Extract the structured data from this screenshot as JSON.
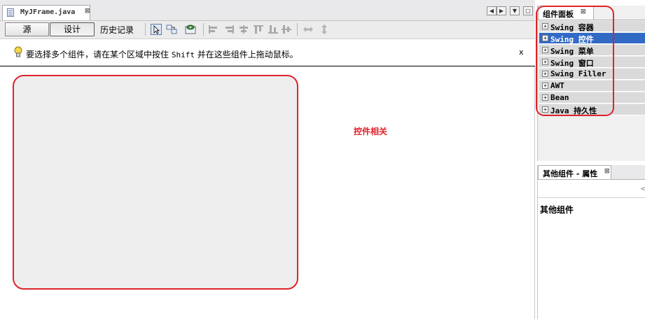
{
  "editor": {
    "tab_title": "MyJFrame.java",
    "tab_close": "⊠",
    "nav_left": "◀",
    "nav_right": "▶",
    "menu_glyph": "▼",
    "maximize_glyph": "□"
  },
  "toolbar": {
    "source_label": "源",
    "design_label": "设计",
    "history_label": "历史记录"
  },
  "hint": {
    "text_before": "要选择多个组件，请在某个区域中按住",
    "key": "Shift",
    "text_after": "并在这些组件上拖动鼠标。",
    "close_label": "x"
  },
  "canvas": {
    "annotation": "控件相关",
    "highlight_color": "#e0222c"
  },
  "palette": {
    "title": "组件面板",
    "close_label": "⊠",
    "categories": [
      {
        "label": "Swing 容器",
        "selected": false
      },
      {
        "label": "Swing 控件",
        "selected": true
      },
      {
        "label": "Swing 菜单",
        "selected": false
      },
      {
        "label": "Swing 窗口",
        "selected": false
      },
      {
        "label": "Swing Filler",
        "selected": false
      },
      {
        "label": "AWT",
        "selected": false
      },
      {
        "label": "Bean",
        "selected": false
      },
      {
        "label": "Java 持久性",
        "selected": false
      }
    ],
    "expand_glyph": "+",
    "selection_color": "#316ac5"
  },
  "properties": {
    "title": "其他组件 - 属性",
    "close_label": "⊠",
    "scroll_glyph": "<",
    "content_title": "其他组件"
  }
}
